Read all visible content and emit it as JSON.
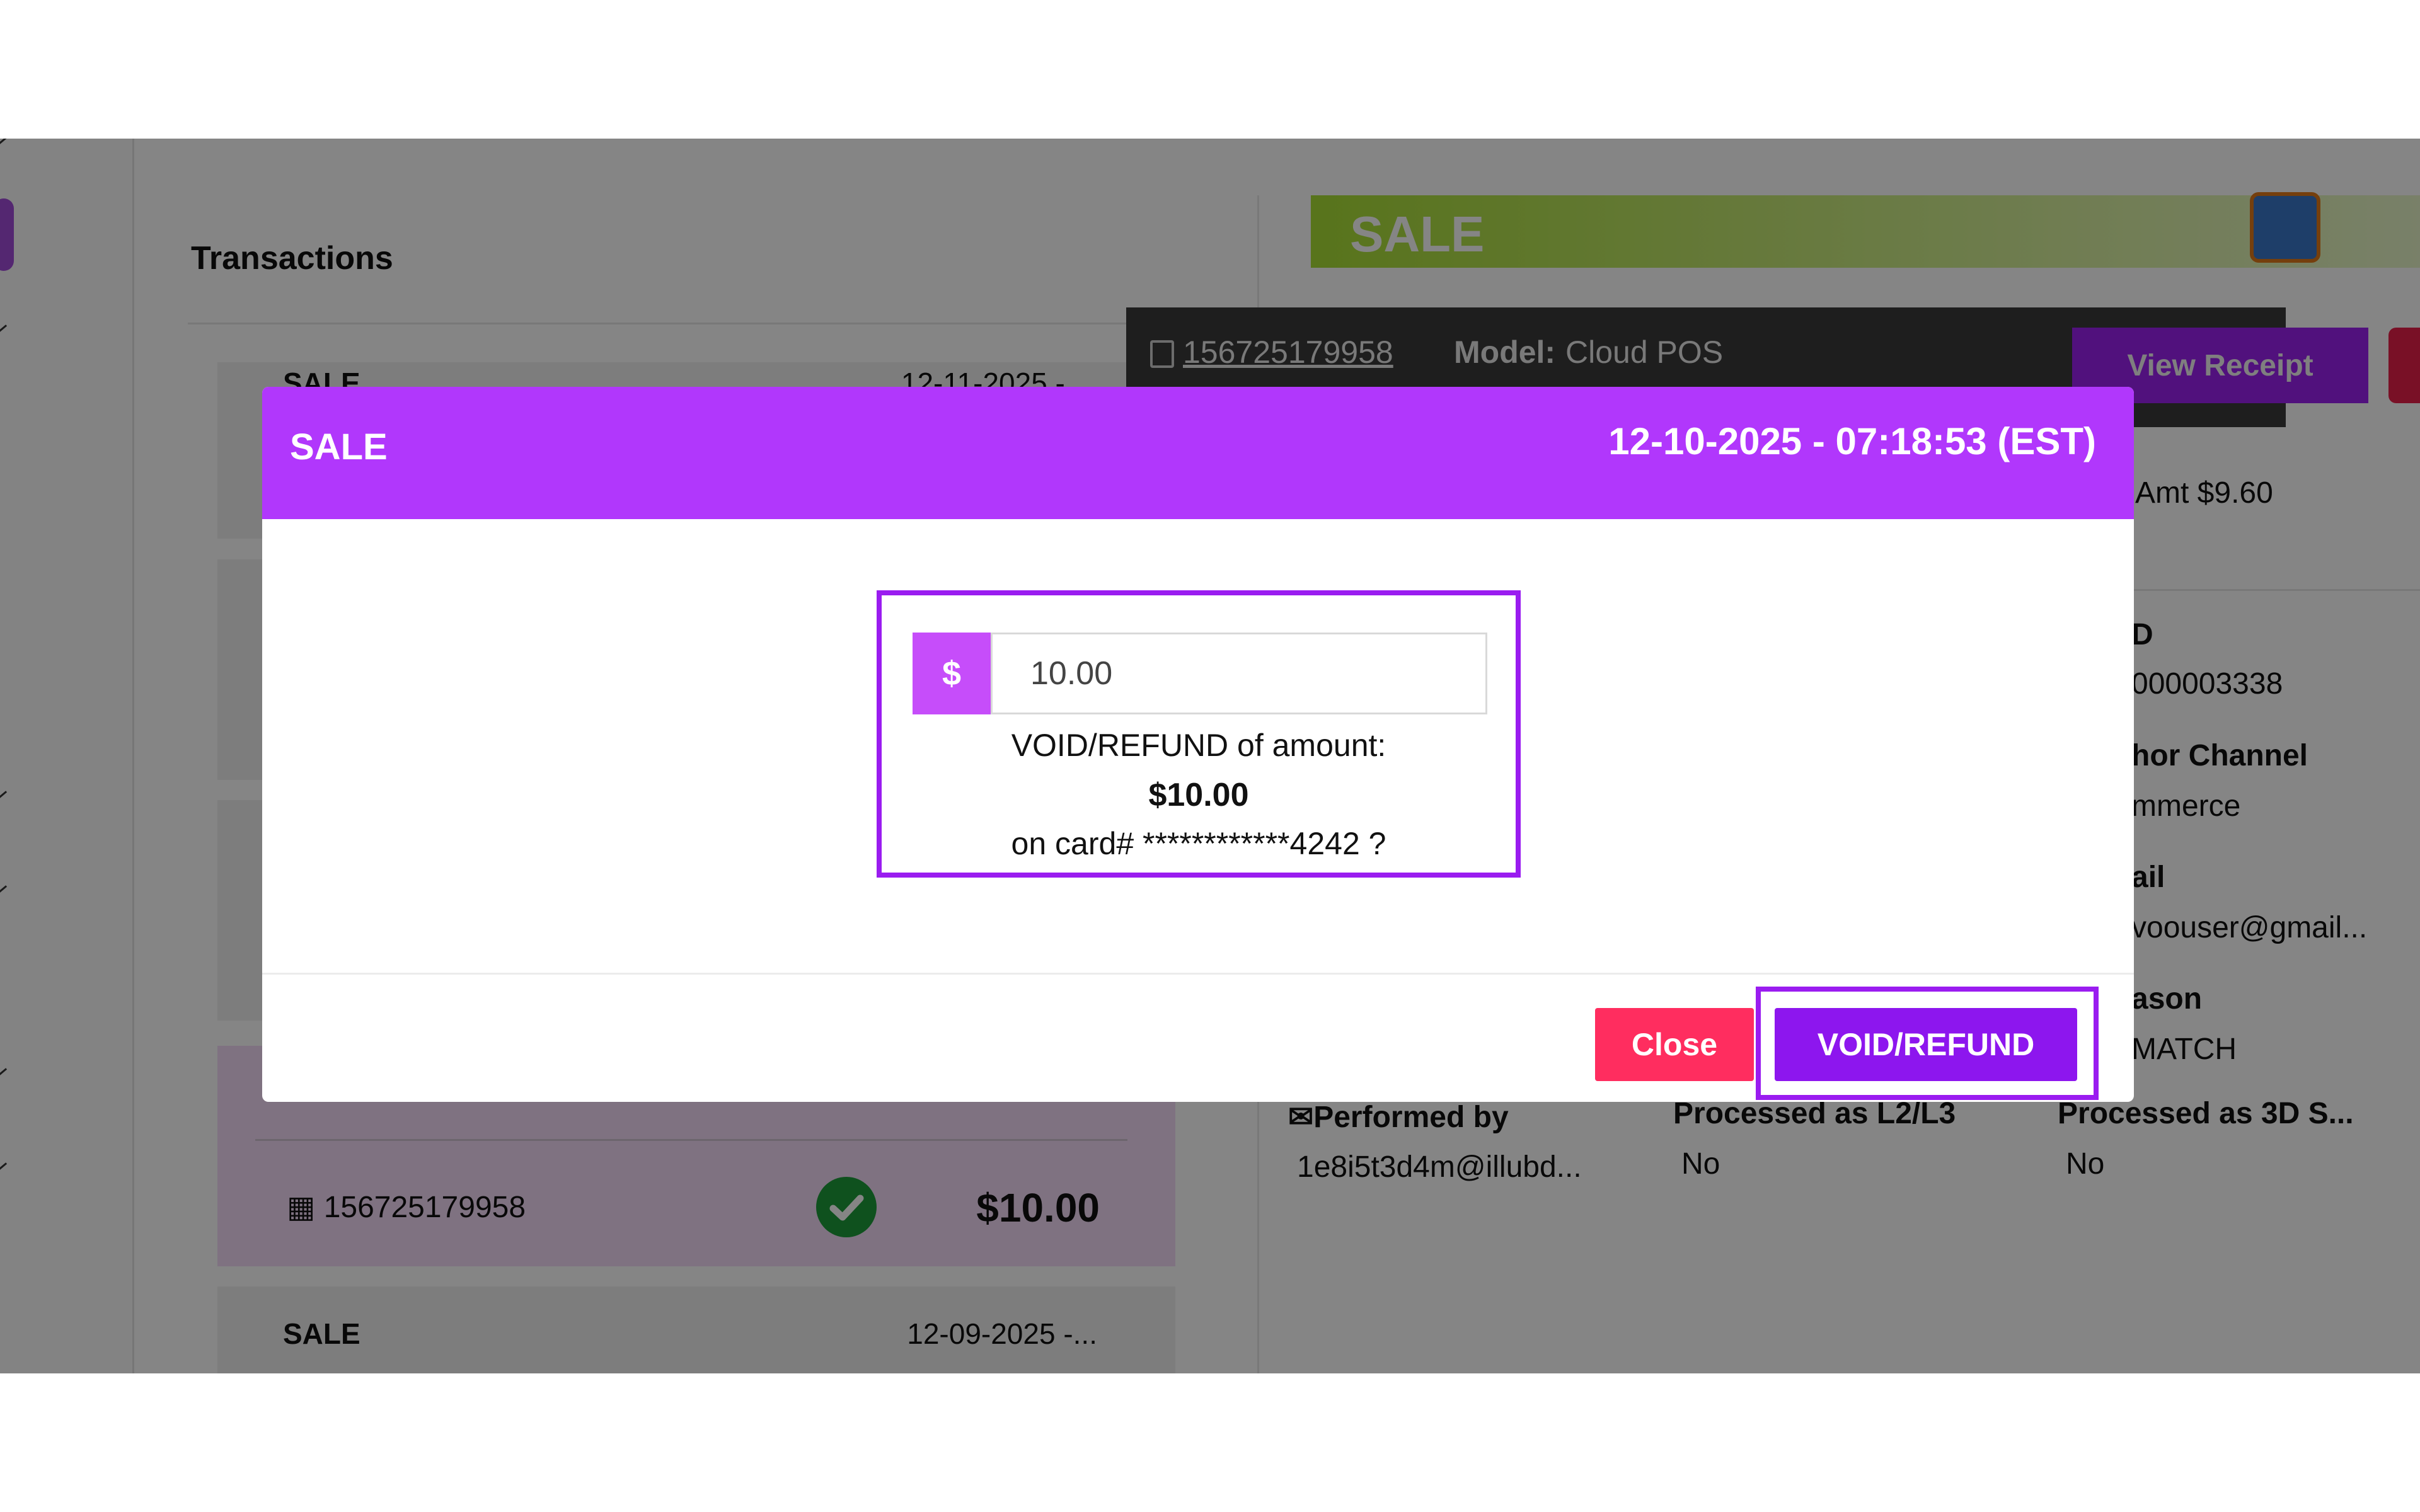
{
  "transactions": {
    "title": "Transactions",
    "cards": [
      {
        "type": "SALE",
        "date": "12-11-2025 - ..."
      },
      {
        "type": "SALE",
        "date": "12-09-2025 -..."
      }
    ],
    "selected": {
      "txid": "156725179958",
      "amount": "$10.00"
    }
  },
  "detail": {
    "banner": "SALE",
    "txid": "156725179958",
    "model_label": "Model:",
    "model_value": "Cloud POS",
    "view_receipt": "View Receipt",
    "amt": "Amt $9.60",
    "field_d_label": "D",
    "field_d_value": "000003338",
    "channel_label": "hor Channel",
    "channel_value": "mmerce",
    "email_label": "ail",
    "email_value": "voouser@gmail...",
    "reason_label": "ason",
    "reason_value": "MATCH",
    "performed_by_label": "Performed by",
    "performed_by_value": "1e8i5t3d4m@illubd...",
    "l2l3_label": "Processed as L2/L3",
    "l2l3_value": "No",
    "threeds_label": "Processed as 3D S...",
    "threeds_value": "No"
  },
  "modal": {
    "title": "SALE",
    "date": "12-10-2025 - 07:18:53 (EST)",
    "currency_symbol": "$",
    "amount_value": "10.00",
    "confirm_line1": "VOID/REFUND of amount:",
    "confirm_amount": "$10.00",
    "confirm_line2": "on card# ************4242 ?",
    "close_label": "Close",
    "void_label": "VOID/REFUND"
  },
  "colors": {
    "accent": "#b137fc",
    "void_button": "#8d16ee",
    "close_button": "#ff2d5f",
    "success": "#1e9b3a"
  }
}
